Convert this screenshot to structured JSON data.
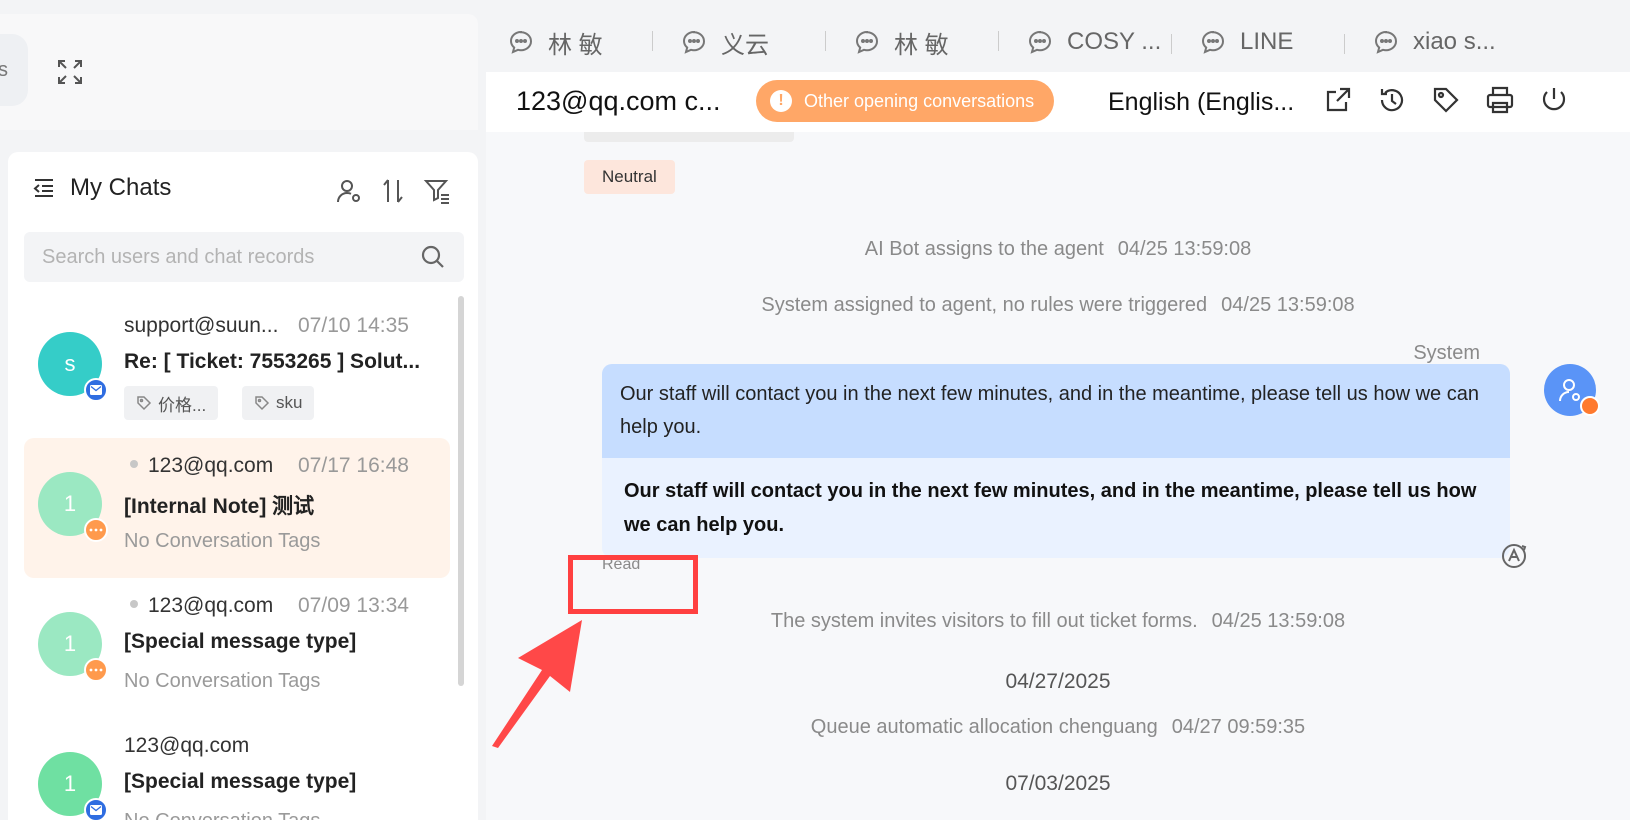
{
  "left_top": {
    "stub_text": "s"
  },
  "my_chats": {
    "title": "My Chats",
    "search_placeholder": "Search users and chat records"
  },
  "chats": [
    {
      "avatar": "s",
      "name": "support@suun...",
      "time": "07/10 14:35",
      "subject": "Re: [ Ticket: 7553265 ] Solut...",
      "tags": [
        "价格...",
        "sku"
      ],
      "channel": "mail",
      "avatar_color": "#35cdc8",
      "active": false
    },
    {
      "avatar": "1",
      "name": "123@qq.com",
      "time": "07/17 16:48",
      "subject": "[Internal Note] 测试",
      "tags_text": "No Conversation Tags",
      "channel": "chat",
      "avatar_color": "#9be8c2",
      "active": true
    },
    {
      "avatar": "1",
      "name": "123@qq.com",
      "time": "07/09 13:34",
      "subject": "[Special message type]",
      "tags_text": "No Conversation Tags",
      "channel": "chat",
      "avatar_color": "#9be8c2",
      "active": false
    },
    {
      "avatar": "1",
      "name": "123@qq.com",
      "time": "",
      "subject": "[Special message type]",
      "tags_text": "No Conversation Tags",
      "channel": "mail",
      "avatar_color": "#6fe0a2",
      "active": false
    }
  ],
  "tabs": [
    {
      "label": "林 敏"
    },
    {
      "label": "义云"
    },
    {
      "label": "林 敏"
    },
    {
      "label": "COSY ..."
    },
    {
      "label": "LINE"
    },
    {
      "label": "xiao s..."
    }
  ],
  "header": {
    "conversation_title": "123@qq.com c...",
    "other_button": "Other opening conversations",
    "language": "English (Englis..."
  },
  "messages": {
    "sentiment": "Neutral",
    "system_events": [
      {
        "text": "AI Bot assigns to the agent",
        "time": "04/25 13:59:08"
      },
      {
        "text": "System assigned to agent, no rules were triggered",
        "time": "04/25 13:59:08"
      }
    ],
    "sender": "System",
    "bubble_original": "Our staff will contact you in the next few minutes, and in the meantime, please tell us how we can help you.",
    "bubble_translated": "Our staff will contact you in the next few minutes, and in the meantime, please tell us how we can help you.",
    "read_status": "Read",
    "ticket_event": {
      "text": "The system invites visitors to fill out ticket forms.",
      "time": "04/25 13:59:08"
    },
    "date_1": "04/27/2025",
    "queue_event": {
      "text": "Queue automatic allocation chenguang",
      "time": "04/27 09:59:35"
    },
    "date_2": "07/03/2025"
  },
  "colors": {
    "accent_orange": "#ffa767",
    "annotation_red": "#ff4040",
    "agent_blue": "#5a94f7"
  }
}
